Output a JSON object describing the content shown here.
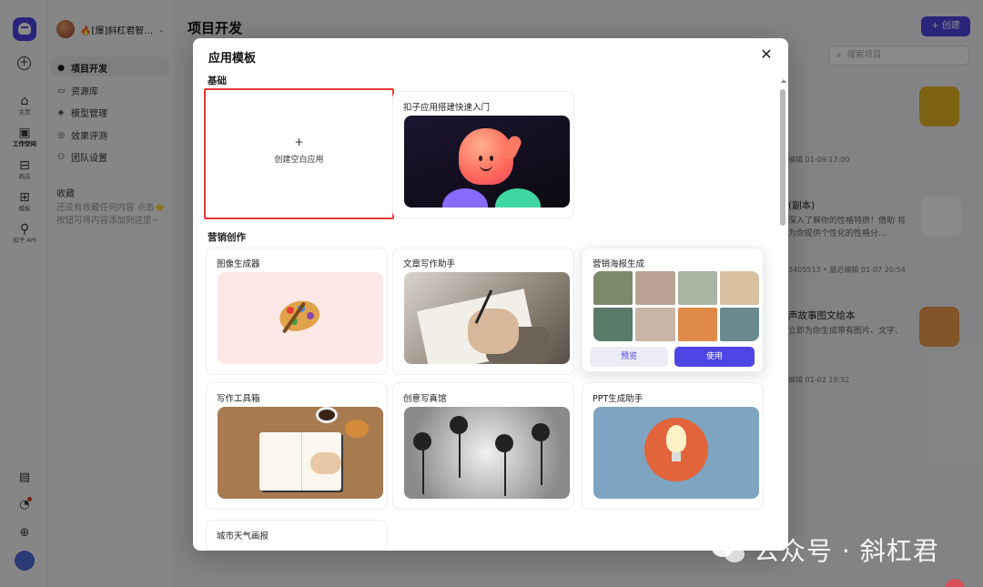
{
  "app": {
    "rail": {
      "items": [
        {
          "label": "主页"
        },
        {
          "label": "工作空间"
        },
        {
          "label": "商店"
        },
        {
          "label": "模板"
        },
        {
          "label": "扣子 API"
        }
      ]
    },
    "workspace_name": "🔥[爆]斜杠君智…",
    "sidebar": {
      "items": [
        {
          "label": "项目开发"
        },
        {
          "label": "资源库"
        },
        {
          "label": "模型管理"
        },
        {
          "label": "效果评测"
        },
        {
          "label": "团队设置"
        }
      ],
      "favorites_title": "收藏",
      "favorites_empty": "还没有收藏任何内容 点击⭐按钮可将内容添加到这里~"
    },
    "page_title": "项目开发",
    "create_button": "+ 创建",
    "search_placeholder": "搜索项目",
    "bg_cards": [
      {
        "meta": "编辑 01-09 17:00"
      },
      {
        "title": "(副本)",
        "desc": "深入了解你的性格特质！借助 将为你提供个性化的性格分…",
        "meta": "3405513 • 最近编辑 01-07 20:54"
      },
      {
        "title": "声故事图文绘本",
        "desc": "立即为你生成带有图片、文字、",
        "meta": "编辑 01-02 19:52"
      }
    ]
  },
  "modal": {
    "title": "应用模板",
    "sections": [
      {
        "title": "基础"
      },
      {
        "title": "营销创作"
      }
    ],
    "blank_card": {
      "plus": "+",
      "label": "创建空白应用"
    },
    "cards": [
      {
        "name": "扣子应用搭建快速入门"
      },
      {
        "name": "图像生成器"
      },
      {
        "name": "文章写作助手"
      },
      {
        "name": "营销海报生成",
        "preview_label": "预览",
        "use_label": "使用"
      },
      {
        "name": "写作工具箱"
      },
      {
        "name": "创意写真馆"
      },
      {
        "name": "PPT生成助手"
      },
      {
        "name": "城市天气画报"
      }
    ],
    "poster_tiles": [
      "#7b8a6a",
      "#b9a394",
      "#a7b5a3",
      "#d8c0a0",
      "#5a7a6a",
      "#c9b4a8",
      "#e08a4a",
      "#6a8a90"
    ]
  },
  "watermark": "公众号 · 斜杠君"
}
